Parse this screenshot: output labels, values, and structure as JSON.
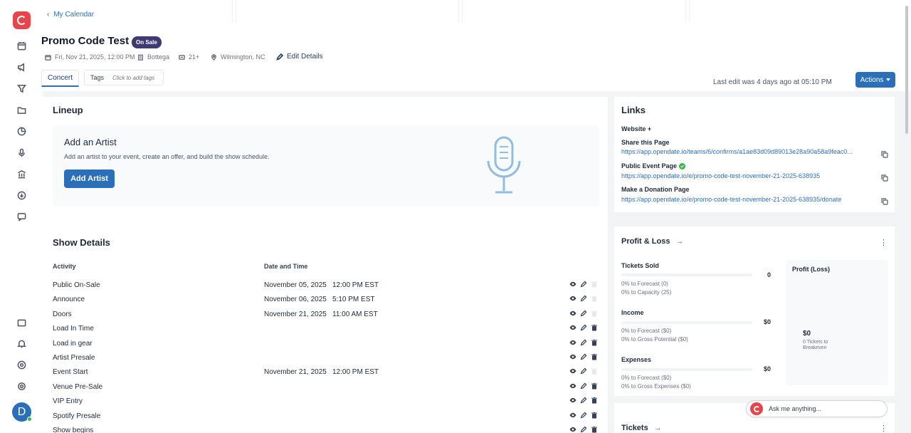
{
  "sidebar": {
    "items": [
      {
        "icon": "calendar-icon"
      },
      {
        "icon": "megaphone-icon"
      },
      {
        "icon": "filter-icon"
      },
      {
        "icon": "folder-icon"
      },
      {
        "icon": "chart-pie-icon"
      },
      {
        "icon": "microphone-icon"
      },
      {
        "icon": "building-icon"
      },
      {
        "icon": "download-icon"
      },
      {
        "icon": "chat-icon"
      }
    ],
    "bottom_items": [
      {
        "icon": "window-icon"
      },
      {
        "icon": "bell-icon"
      },
      {
        "icon": "help-icon"
      },
      {
        "icon": "settings-icon"
      }
    ],
    "avatar_initial": "D"
  },
  "header": {
    "back_label": "My Calendar",
    "title": "Promo Code Test",
    "badge": "On Sale",
    "date": "Fri, Nov 21, 2025, 12:00 PM",
    "venue": "Bottega",
    "age": "21+",
    "location": "Wilmington, NC",
    "edit_label": "Edit Details",
    "tab": "Concert",
    "tags_label": "Tags",
    "tags_placeholder": "Click to add tags",
    "last_edit": "Last edit was 4 days ago at 05:10 PM",
    "actions_label": "Actions"
  },
  "lineup": {
    "title": "Lineup",
    "add_title": "Add an Artist",
    "add_desc": "Add an artist to your event, create an offer, and build the show schedule.",
    "add_button": "Add Artist"
  },
  "show_details": {
    "title": "Show Details",
    "col_activity": "Activity",
    "col_datetime": "Date and Time",
    "rows": [
      {
        "activity": "Public On-Sale",
        "date": "November 05, 2025",
        "time": "12:00 PM EST",
        "deletable": false
      },
      {
        "activity": "Announce",
        "date": "November 06, 2025",
        "time": "5:10 PM EST",
        "deletable": false
      },
      {
        "activity": "Doors",
        "date": "November 21, 2025",
        "time": "11:00 AM EST",
        "deletable": false
      },
      {
        "activity": "Load In Time",
        "date": "",
        "time": "",
        "deletable": true
      },
      {
        "activity": "Load in gear",
        "date": "",
        "time": "",
        "deletable": true
      },
      {
        "activity": "Artist Presale",
        "date": "",
        "time": "",
        "deletable": true
      },
      {
        "activity": "Event Start",
        "date": "November 21, 2025",
        "time": "12:00 PM EST",
        "deletable": false
      },
      {
        "activity": "Venue Pre-Sale",
        "date": "",
        "time": "",
        "deletable": true
      },
      {
        "activity": "VIP Entry",
        "date": "",
        "time": "",
        "deletable": true
      },
      {
        "activity": "Spotify Presale",
        "date": "",
        "time": "",
        "deletable": true
      },
      {
        "activity": "Show begins",
        "date": "",
        "time": "",
        "deletable": true
      }
    ]
  },
  "links": {
    "title": "Links",
    "website_label": "Website +",
    "share_label": "Share this Page",
    "share_url": "https://app.opendate.io/teams/6/confirms/a1ae83d09d89013e28a90a58a9feac0...",
    "public_label": "Public Event Page",
    "public_url": "https://app.opendate.io/e/promo-code-test-november-21-2025-638935",
    "donation_label": "Make a Donation Page",
    "donation_url": "https://app.opendate.io/e/promo-code-test-november-21-2025-638935/donate"
  },
  "profit_loss": {
    "title": "Profit & Loss",
    "tickets_sold_label": "Tickets Sold",
    "tickets_sold_value": "0",
    "tickets_forecast": "0% to Forecast (0)",
    "tickets_capacity": "0% to Capacity (25)",
    "income_label": "Income",
    "income_value": "$0",
    "income_forecast": "0% to Forecast ($0)",
    "income_potential": "0% to Gross Potential ($0)",
    "expenses_label": "Expenses",
    "expenses_value": "$0",
    "expenses_forecast": "0% to Forecast ($0)",
    "expenses_gross": "0% to Gross Expenses ($0)",
    "profit_label": "Profit (Loss)",
    "profit_value": "$0",
    "breakeven_line1": "0 Tickets to",
    "breakeven_line2": "Breakeven"
  },
  "tickets": {
    "title": "Tickets"
  },
  "chat": {
    "placeholder": "Ask me anything..."
  },
  "colors": {
    "accent": "#2a6fb8",
    "brand": "#e8454a",
    "badge": "#3f3a73",
    "verified": "#3bb54a"
  }
}
